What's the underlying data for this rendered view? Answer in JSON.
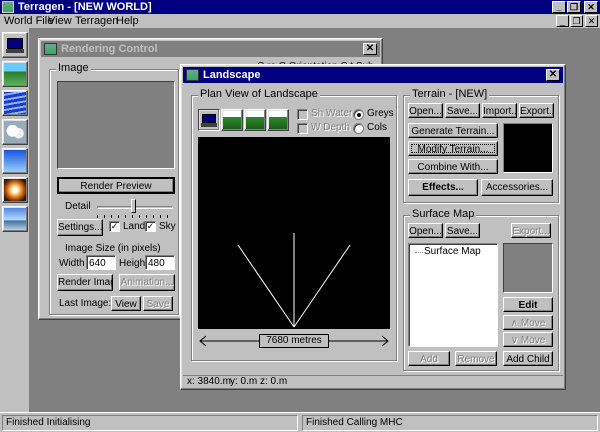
{
  "app": {
    "title": "Terragen - [NEW WORLD]",
    "menu": [
      "World File",
      "View",
      "Terragen",
      "Help"
    ],
    "window_controls": [
      "_",
      "❐",
      "✕"
    ],
    "mdi_controls": [
      "_",
      "❐",
      "✕"
    ]
  },
  "toolbar": {
    "tools": [
      "landscape-view-icon",
      "terrain-mountains-icon",
      "water-icon",
      "clouds-icon",
      "sky-gradient-icon",
      "sun-icon",
      "render-preview-icon"
    ]
  },
  "rendering_control": {
    "title": "Rendering Control",
    "obscured_header": "C     ra    C  Orientation  C  t Sub",
    "image_group": "Image",
    "render_preview": "Render Preview",
    "detail_label": "Detail",
    "detail_level": 0.45,
    "settings": "Settings...",
    "land_label": "Land",
    "land_checked": true,
    "sky_label": "Sky",
    "sky_checked": true,
    "image_size_label": "Image Size (in pixels)",
    "width_label": "Width",
    "width_value": "640",
    "height_label": "Height",
    "height_value": "480",
    "render_image": "Render Image",
    "animation": "Animation...",
    "last_image_label": "Last Image:",
    "view": "View",
    "save": "Save"
  },
  "landscape": {
    "title": "Landscape",
    "plan_view_group": "Plan View of Landscape",
    "view_tools": [
      "plan-view-icon",
      "shaded-view-1-icon",
      "shaded-view-2-icon",
      "shaded-view-3-icon"
    ],
    "sh_water": "Sh Water",
    "w_depth": "W Depth",
    "greys": "Greys",
    "cols": "Cols",
    "greys_selected": true,
    "scale_label": "7680 metres",
    "status": {
      "x": "x: 3840.m",
      "y": "y: 0.m",
      "z": "z: 0.m"
    },
    "terrain": {
      "group": "Terrain - [NEW]",
      "open": "Open...",
      "save": "Save...",
      "import": "Import...",
      "export": "Export...",
      "generate": "Generate Terrain...",
      "modify": "Modify Terrain...",
      "combine": "Combine With...",
      "effects": "Effects...",
      "accessories": "Accessories..."
    },
    "surface": {
      "group": "Surface Map",
      "open": "Open...",
      "save": "Save...",
      "export": "Export...",
      "tree_item": "Surface Map",
      "edit": "Edit",
      "move_up": "Move",
      "move_down": "Move",
      "add": "Add",
      "remove": "Remove",
      "add_child": "Add Child"
    }
  },
  "statusbar": {
    "left": "Finished Initialising",
    "right": "Finished Calling MHC"
  }
}
